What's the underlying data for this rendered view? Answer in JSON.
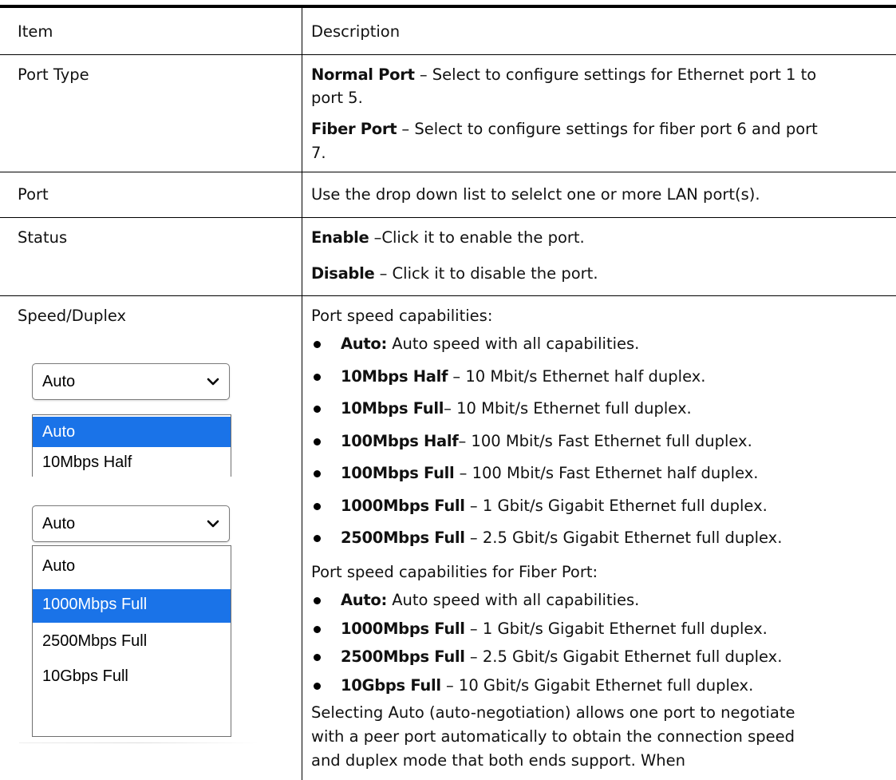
{
  "table": {
    "header": {
      "item": "Item",
      "description": "Description"
    },
    "port_type": {
      "item": "Port Type",
      "normal_label": "Normal Port",
      "normal_text_1": " – Select to configure settings for Ethernet port 1 to",
      "normal_text_2": "port 5.",
      "fiber_label": "Fiber Port",
      "fiber_text_1": " – Select to configure settings for fiber port 6 and port",
      "fiber_text_2": "7."
    },
    "port": {
      "item": "Port",
      "text": "Use the drop down list to selelct one or more LAN port(s)."
    },
    "status": {
      "item": "Status",
      "enable_label": "Enable",
      "enable_text": " –Click it to enable the port.",
      "disable_label": "Disable",
      "disable_text": " – Click it to disable the port."
    },
    "speed_duplex": {
      "item": "Speed/Duplex",
      "intro": "Port speed capabilities:",
      "bullets": [
        {
          "label": "Auto:",
          "text": " Auto speed with all capabilities."
        },
        {
          "label": "10Mbps Half",
          "text": " – 10 Mbit/s Ethernet half duplex."
        },
        {
          "label": "10Mbps Full",
          "text": "– 10 Mbit/s Ethernet full duplex."
        },
        {
          "label": "100Mbps Half",
          "text": "– 100 Mbit/s Fast Ethernet full duplex."
        },
        {
          "label": "100Mbps Full",
          "text": " – 100 Mbit/s Fast Ethernet half duplex."
        },
        {
          "label": "1000Mbps Full",
          "text": " – 1 Gbit/s Gigabit Ethernet full duplex."
        },
        {
          "label": "2500Mbps Full",
          "text": " – 2.5 Gbit/s Gigabit Ethernet full duplex."
        }
      ],
      "fiber_intro": "Port speed capabilities for Fiber Port:",
      "fiber_bullets": [
        {
          "label": "Auto:",
          "text": " Auto speed with all capabilities."
        },
        {
          "label": "1000Mbps Full",
          "text": " – 1 Gbit/s Gigabit Ethernet full duplex."
        },
        {
          "label": "2500Mbps Full",
          "text": " – 2.5 Gbit/s Gigabit Ethernet full duplex."
        },
        {
          "label": "10Gbps Full",
          "text": " – 10 Gbit/s Gigabit Ethernet full duplex."
        }
      ],
      "para": [
        "Selecting Auto (auto-negotiation) allows one port to negotiate",
        "with a peer port automatically to obtain the connection speed",
        "and duplex mode that both ends support. When"
      ]
    }
  },
  "dropdown_normal": {
    "selected_value": "Auto",
    "options": [
      "Auto",
      "10Mbps Half"
    ],
    "highlighted": "Auto",
    "icon": "chevron-down-icon"
  },
  "dropdown_fiber": {
    "selected_value": "Auto",
    "options": [
      "Auto",
      "1000Mbps Full",
      "2500Mbps Full",
      "10Gbps Full"
    ],
    "highlighted": "1000Mbps Full",
    "icon": "chevron-down-icon"
  },
  "colors": {
    "highlight": "#1a73e8"
  }
}
